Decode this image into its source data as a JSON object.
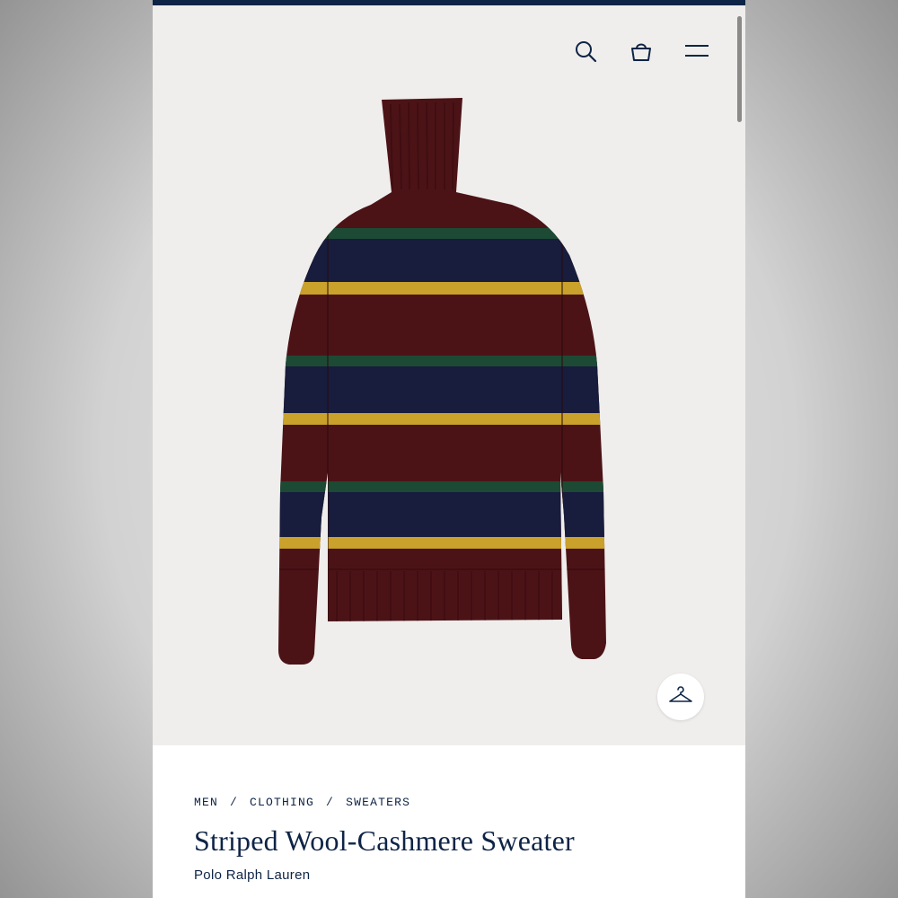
{
  "header": {
    "icons": [
      "search-icon",
      "shopping-bag-icon",
      "menu-icon"
    ]
  },
  "colors": {
    "navy": "#0e2446",
    "sweater_burgundy": "#4c1317",
    "sweater_navy": "#181c3d",
    "sweater_green": "#1d4a34",
    "sweater_gold": "#c9a12b"
  },
  "hero": {
    "action_icon": "hanger-icon"
  },
  "breadcrumb": {
    "items": [
      "MEN",
      "CLOTHING",
      "SWEATERS"
    ],
    "separator": "/"
  },
  "product": {
    "title": "Striped Wool-Cashmere Sweater",
    "brand": "Polo Ralph Lauren"
  }
}
